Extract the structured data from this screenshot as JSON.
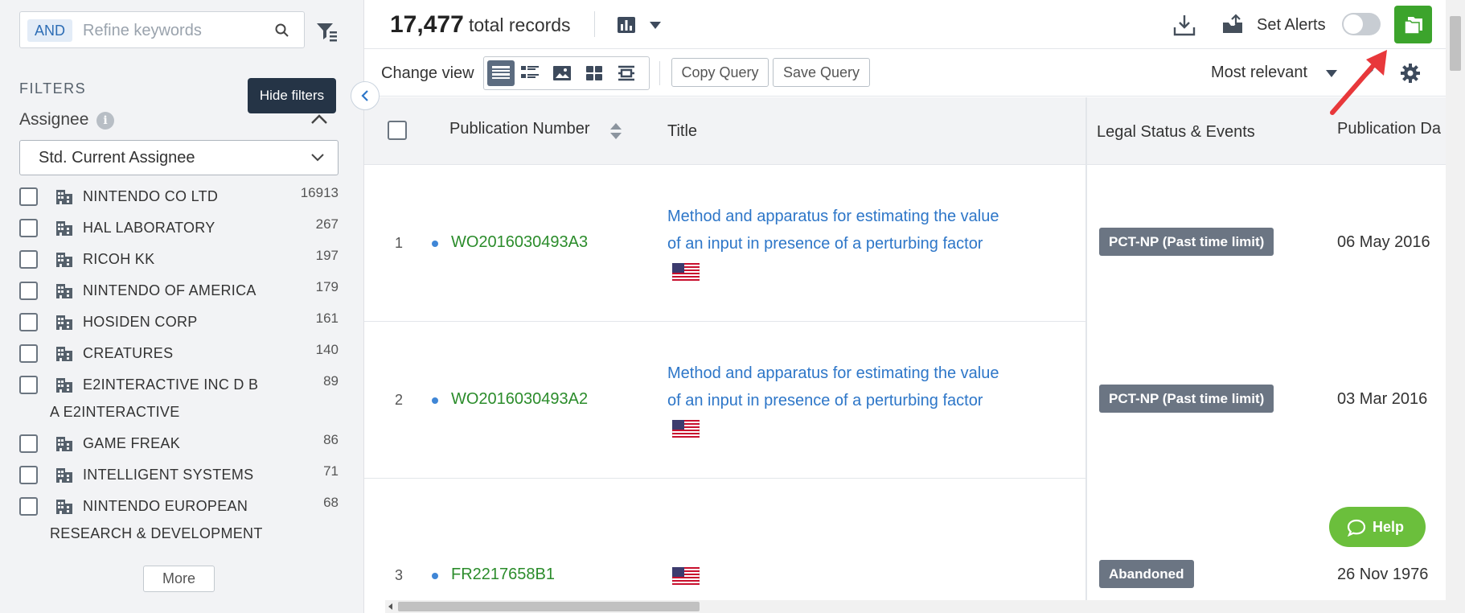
{
  "sidebar": {
    "search": {
      "and_label": "AND",
      "placeholder": "Refine keywords"
    },
    "filters_heading": "FILTERS",
    "tooltip": "Hide filters",
    "assignee_heading": "Assignee",
    "info_glyph": "i",
    "select_value": "Std. Current Assignee",
    "items": [
      {
        "name": "NINTENDO CO LTD",
        "name2": "",
        "count": "16913"
      },
      {
        "name": "HAL LABORATORY",
        "name2": "",
        "count": "267"
      },
      {
        "name": "RICOH KK",
        "name2": "",
        "count": "197"
      },
      {
        "name": "NINTENDO OF AMERICA",
        "name2": "",
        "count": "179"
      },
      {
        "name": "HOSIDEN CORP",
        "name2": "",
        "count": "161"
      },
      {
        "name": "CREATURES",
        "name2": "",
        "count": "140"
      },
      {
        "name": "E2INTERACTIVE INC D B",
        "name2": "A E2INTERACTIVE",
        "count": "89"
      },
      {
        "name": "GAME FREAK",
        "name2": "",
        "count": "86"
      },
      {
        "name": "INTELLIGENT SYSTEMS",
        "name2": "",
        "count": "71"
      },
      {
        "name": "NINTENDO EUROPEAN",
        "name2": "RESEARCH & DEVELOPMENT",
        "count": "68"
      }
    ],
    "more_label": "More"
  },
  "header": {
    "total_count": "17,477",
    "total_label": "total records",
    "set_alerts_label": "Set Alerts",
    "alerts_enabled": false
  },
  "toolbar": {
    "change_view_label": "Change view",
    "copy_query_label": "Copy Query",
    "save_query_label": "Save Query",
    "sort_label": "Most relevant"
  },
  "table": {
    "columns": {
      "publication_number": "Publication Number",
      "title": "Title",
      "legal_status": "Legal Status & Events",
      "publication_date": "Publication Da"
    },
    "rows": [
      {
        "num": "1",
        "pub": "WO2016030493A3",
        "title": "Method and apparatus for estimating the value of an input in presence of a perturbing factor",
        "status": "PCT-NP (Past time limit)",
        "date": "06 May 2016"
      },
      {
        "num": "2",
        "pub": "WO2016030493A2",
        "title": "Method and apparatus for estimating the value of an input in presence of a perturbing factor",
        "status": "PCT-NP (Past time limit)",
        "date": "03 Mar 2016"
      },
      {
        "num": "3",
        "pub": "FR2217658B1",
        "title": "",
        "status": "Abandoned",
        "date": "26 Nov 1976"
      }
    ]
  },
  "help_label": "Help",
  "colors": {
    "accent_green": "#3ca42c",
    "link_blue": "#2d76c8",
    "pub_green": "#2b8c2b",
    "status_gray": "#6b7583",
    "help_green": "#6bbf3c",
    "annotation_red": "#e8383b"
  },
  "icons": [
    "search-icon",
    "filter-icon",
    "info-icon",
    "chevron-up-icon",
    "chevron-down-icon",
    "building-icon",
    "chevron-left-icon",
    "bar-chart-icon",
    "download-icon",
    "share-icon",
    "folders-icon",
    "list-view-icon",
    "detail-view-icon",
    "image-view-icon",
    "grid-view-icon",
    "compare-view-icon",
    "sort-icon",
    "edit-icon",
    "gear-icon",
    "us-flag-icon",
    "chat-icon",
    "red-arrow-annotation"
  ]
}
